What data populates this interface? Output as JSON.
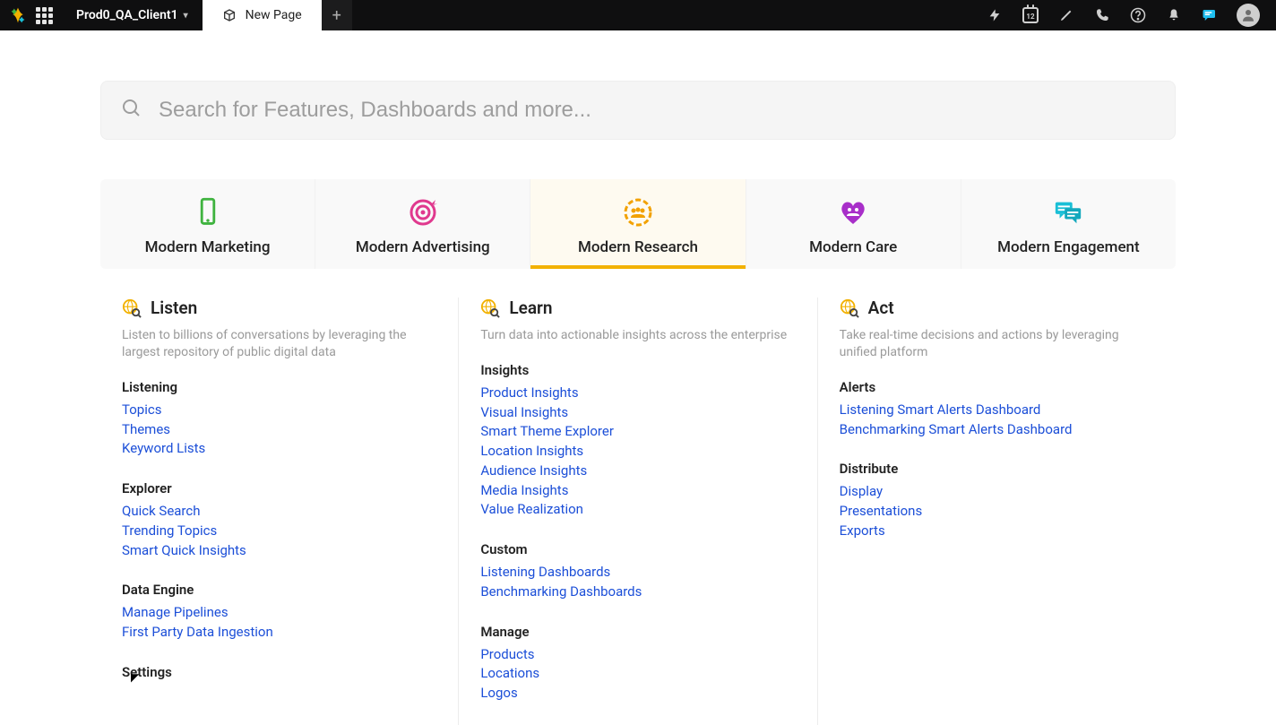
{
  "topbar": {
    "client_name": "Prod0_QA_Client1",
    "tab_label": "New Page",
    "calendar_day": "12"
  },
  "search": {
    "placeholder": "Search for Features, Dashboards and more..."
  },
  "categories": [
    {
      "id": "marketing",
      "label": "Modern Marketing",
      "active": false
    },
    {
      "id": "advertising",
      "label": "Modern Advertising",
      "active": false
    },
    {
      "id": "research",
      "label": "Modern Research",
      "active": true
    },
    {
      "id": "care",
      "label": "Modern Care",
      "active": false
    },
    {
      "id": "engagement",
      "label": "Modern Engagement",
      "active": false
    }
  ],
  "columns": [
    {
      "id": "listen",
      "title": "Listen",
      "desc": "Listen to billions of conversations by leveraging the largest repository of public digital data",
      "groups": [
        {
          "title": "Listening",
          "links": [
            "Topics",
            "Themes",
            "Keyword Lists"
          ]
        },
        {
          "title": "Explorer",
          "links": [
            "Quick Search",
            "Trending Topics",
            "Smart Quick Insights"
          ]
        },
        {
          "title": "Data Engine",
          "links": [
            "Manage Pipelines",
            "First Party Data Ingestion"
          ]
        },
        {
          "title": "Settings",
          "links": []
        }
      ]
    },
    {
      "id": "learn",
      "title": "Learn",
      "desc": "Turn data into actionable insights across the enterprise",
      "groups": [
        {
          "title": "Insights",
          "links": [
            "Product Insights",
            "Visual Insights",
            "Smart Theme Explorer",
            "Location Insights",
            "Audience Insights",
            "Media Insights",
            "Value Realization"
          ]
        },
        {
          "title": "Custom",
          "links": [
            "Listening Dashboards",
            "Benchmarking Dashboards"
          ]
        },
        {
          "title": "Manage",
          "links": [
            "Products",
            "Locations",
            "Logos"
          ]
        }
      ]
    },
    {
      "id": "act",
      "title": "Act",
      "desc": "Take real-time decisions and actions by leveraging unified platform",
      "groups": [
        {
          "title": "Alerts",
          "links": [
            "Listening Smart Alerts Dashboard",
            "Benchmarking Smart Alerts Dashboard"
          ]
        },
        {
          "title": "Distribute",
          "links": [
            "Display",
            "Presentations",
            "Exports"
          ]
        }
      ]
    }
  ],
  "colors": {
    "accent_yellow": "#f2b100",
    "link_blue": "#1c4fd8",
    "phone_green": "#3fb33f",
    "target_pink": "#e0398e",
    "heart_purple": "#a82fc9",
    "chat_teal": "#1abfd6"
  }
}
